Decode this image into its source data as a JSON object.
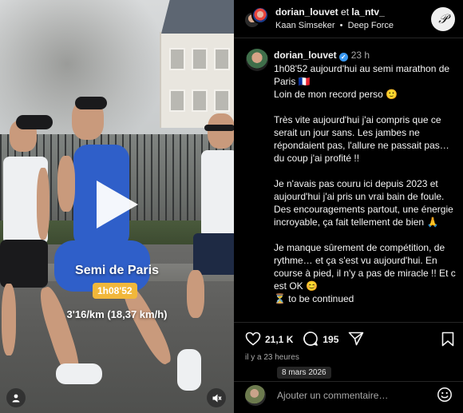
{
  "video": {
    "overlay_title": "Semi de Paris",
    "overlay_time": "1h08'52",
    "overlay_pace": "3'16/km (18,37 km/h)",
    "icons": [
      "play-icon",
      "user-icon",
      "mute-icon"
    ]
  },
  "header": {
    "user1": "dorian_louvet",
    "joiner": "et",
    "user2": "la_ntv_",
    "music_artist": "Kaan Simseker",
    "music_sep": "•",
    "music_track": "Deep Force",
    "logo_glyph": "𝒫"
  },
  "post": {
    "username": "dorian_louvet",
    "time": "23 h",
    "caption_lines": [
      "1h08'52 aujourd'hui au semi marathon de Paris 🇫🇷",
      "Loin de mon record perso 🙂",
      "",
      "Très vite aujourd'hui j'ai compris que ce serait un jour sans. Les jambes ne répondaient pas, l'allure ne passait pas… du coup j'ai profité !!",
      "",
      "Je n'avais pas couru ici depuis 2023 et aujourd'hui j'ai pris un vrai bain de foule. Des encouragements partout, une énergie incroyable, ça fait tellement de bien 🙏",
      "",
      "Je manque sûrement de compétition, de rythme… et ça s'est vu aujourd'hui. En course à pied, il n'y a pas de miracle !! Et c est OK 😊",
      "⏳ to be continued"
    ]
  },
  "actions": {
    "likes": "21,1 K",
    "comments": "195",
    "icons": [
      "heart-icon",
      "comment-icon",
      "share-icon",
      "bookmark-icon"
    ]
  },
  "meta": {
    "ago": "il y a 23 heures",
    "date": "8 mars 2026"
  },
  "comment": {
    "placeholder": "Ajouter un commentaire…"
  },
  "colors": {
    "background": "#000000",
    "text": "#f5f5f5",
    "muted": "#a8a8a8",
    "verified": "#3897f0",
    "time_badge": "#f1b73b"
  }
}
